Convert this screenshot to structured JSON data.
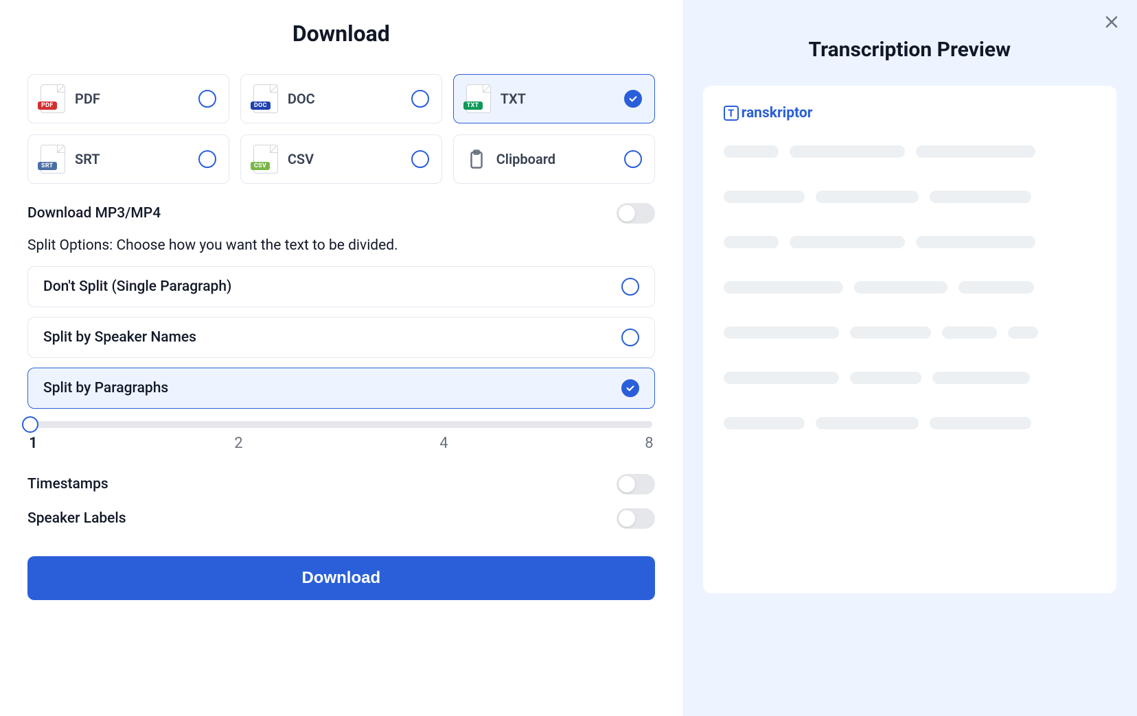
{
  "title": "Download",
  "formats": [
    {
      "id": "pdf",
      "label": "PDF",
      "badge": "PDF",
      "badgeClass": "pdf",
      "selected": false
    },
    {
      "id": "doc",
      "label": "DOC",
      "badge": "DOC",
      "badgeClass": "doc",
      "selected": false
    },
    {
      "id": "txt",
      "label": "TXT",
      "badge": "TXT",
      "badgeClass": "txt",
      "selected": true
    },
    {
      "id": "srt",
      "label": "SRT",
      "badge": "SRT",
      "badgeClass": "srt",
      "selected": false
    },
    {
      "id": "csv",
      "label": "CSV",
      "badge": "CSV",
      "badgeClass": "csv",
      "selected": false
    },
    {
      "id": "clipboard",
      "label": "Clipboard",
      "icon": "clipboard",
      "selected": false
    }
  ],
  "download_media_label": "Download MP3/MP4",
  "download_media_on": false,
  "split_heading": "Split Options: Choose how you want the text to be divided.",
  "split_options": [
    {
      "label": "Don't Split (Single Paragraph)",
      "selected": false
    },
    {
      "label": "Split by Speaker Names",
      "selected": false
    },
    {
      "label": "Split by Paragraphs",
      "selected": true
    }
  ],
  "slider": {
    "min": 1,
    "max": 8,
    "value": 1,
    "ticks": [
      "1",
      "2",
      "4",
      "8"
    ]
  },
  "timestamps_label": "Timestamps",
  "timestamps_on": false,
  "speaker_labels_label": "Speaker Labels",
  "speaker_labels_on": false,
  "download_button": "Download",
  "preview": {
    "title": "Transcription Preview",
    "brand": "ranskriptor"
  }
}
